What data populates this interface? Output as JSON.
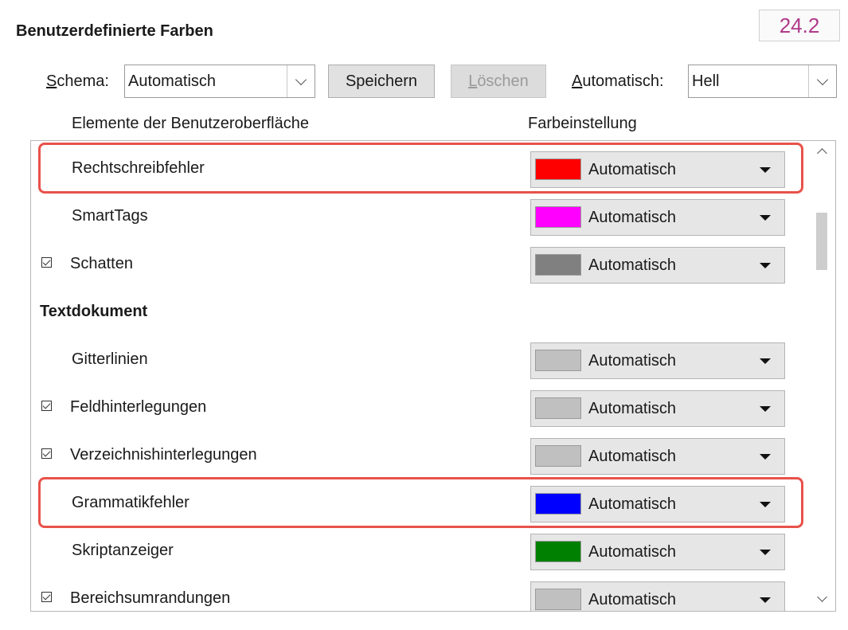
{
  "header": {
    "section_title": "Benutzerdefinierte Farben",
    "version": "24.2"
  },
  "toolbar": {
    "schema_label": "Schema:",
    "schema_label_mnemonic": "S",
    "schema_label_rest": "chema:",
    "schema_value": "Automatisch",
    "save_label": "Speichern",
    "delete_label": "Löschen",
    "delete_label_mnemonic": "L",
    "delete_label_rest": "öschen",
    "auto_label_mnemonic": "A",
    "auto_label_rest": "utomatisch:",
    "auto_value": "Hell"
  },
  "columns": {
    "elements": "Elemente der Benutzeroberfläche",
    "setting": "Farbeinstellung"
  },
  "rows": [
    {
      "type": "item",
      "label": "Rechtschreibfehler",
      "checkbox": false,
      "color": "#ff0000",
      "value": "Automatisch",
      "highlighted": true
    },
    {
      "type": "item",
      "label": "SmartTags",
      "checkbox": false,
      "color": "#ff00ff",
      "value": "Automatisch",
      "highlighted": false
    },
    {
      "type": "item",
      "label": "Schatten",
      "checkbox": true,
      "color": "#808080",
      "value": "Automatisch",
      "highlighted": false
    },
    {
      "type": "category",
      "label": "Textdokument"
    },
    {
      "type": "item",
      "label": "Gitterlinien",
      "checkbox": false,
      "color": "#c0c0c0",
      "value": "Automatisch",
      "highlighted": false
    },
    {
      "type": "item",
      "label": "Feldhinterlegungen",
      "checkbox": true,
      "color": "#c0c0c0",
      "value": "Automatisch",
      "highlighted": false
    },
    {
      "type": "item",
      "label": "Verzeichnishinterlegungen",
      "checkbox": true,
      "color": "#c0c0c0",
      "value": "Automatisch",
      "highlighted": false
    },
    {
      "type": "item",
      "label": "Grammatikfehler",
      "checkbox": false,
      "color": "#0000ff",
      "value": "Automatisch",
      "highlighted": true
    },
    {
      "type": "item",
      "label": "Skriptanzeiger",
      "checkbox": false,
      "color": "#008000",
      "value": "Automatisch",
      "highlighted": false
    },
    {
      "type": "item",
      "label": "Bereichsumrandungen",
      "checkbox": true,
      "color": "#c0c0c0",
      "value": "Automatisch",
      "highlighted": false
    }
  ],
  "colors": {
    "highlight": "#e8524a",
    "version_text": "#b03a8b"
  }
}
